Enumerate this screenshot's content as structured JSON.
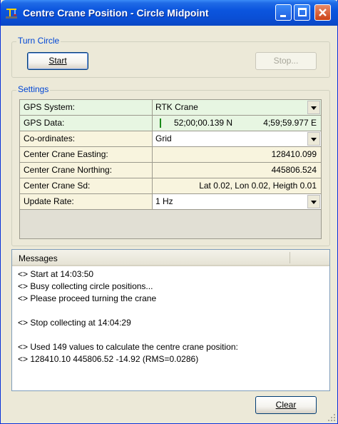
{
  "window": {
    "title": "Centre Crane Position - Circle Midpoint"
  },
  "turn_circle": {
    "group_title": "Turn Circle",
    "start_label": "Start",
    "stop_label": "Stop..."
  },
  "settings": {
    "group_title": "Settings",
    "rows": [
      {
        "label": "GPS System:",
        "value": "RTK Crane"
      },
      {
        "label": "GPS Data:",
        "lat": "52;00;00.139 N",
        "lon": "4;59;59.977 E"
      },
      {
        "label": "Co-ordinates:",
        "value": "Grid"
      },
      {
        "label": "Center Crane Easting:",
        "value": "128410.099"
      },
      {
        "label": "Center Crane Northing:",
        "value": "445806.524"
      },
      {
        "label": "Center Crane Sd:",
        "value": "Lat 0.02, Lon 0.02, Heigth 0.01"
      },
      {
        "label": "Update Rate:",
        "value": "1 Hz"
      }
    ]
  },
  "messages": {
    "header": "Messages",
    "lines": [
      "<> Start at 14:03:50",
      "<> Busy collecting circle positions...",
      "<> Please proceed turning the crane",
      "",
      "<> Stop collecting at 14:04:29",
      "",
      "<> Used 149 values to calculate the centre crane position:",
      "<> 128410.10 445806.52 -14.92 (RMS=0.0286)"
    ]
  },
  "footer": {
    "clear_label": "Clear"
  },
  "colors": {
    "titlebar": "#0a4fd6",
    "group_title": "#0046d5",
    "readonly_cell": "#f8f4de",
    "gps_cell": "#e7f6e2",
    "gps_signal": "#1a8a1a"
  }
}
